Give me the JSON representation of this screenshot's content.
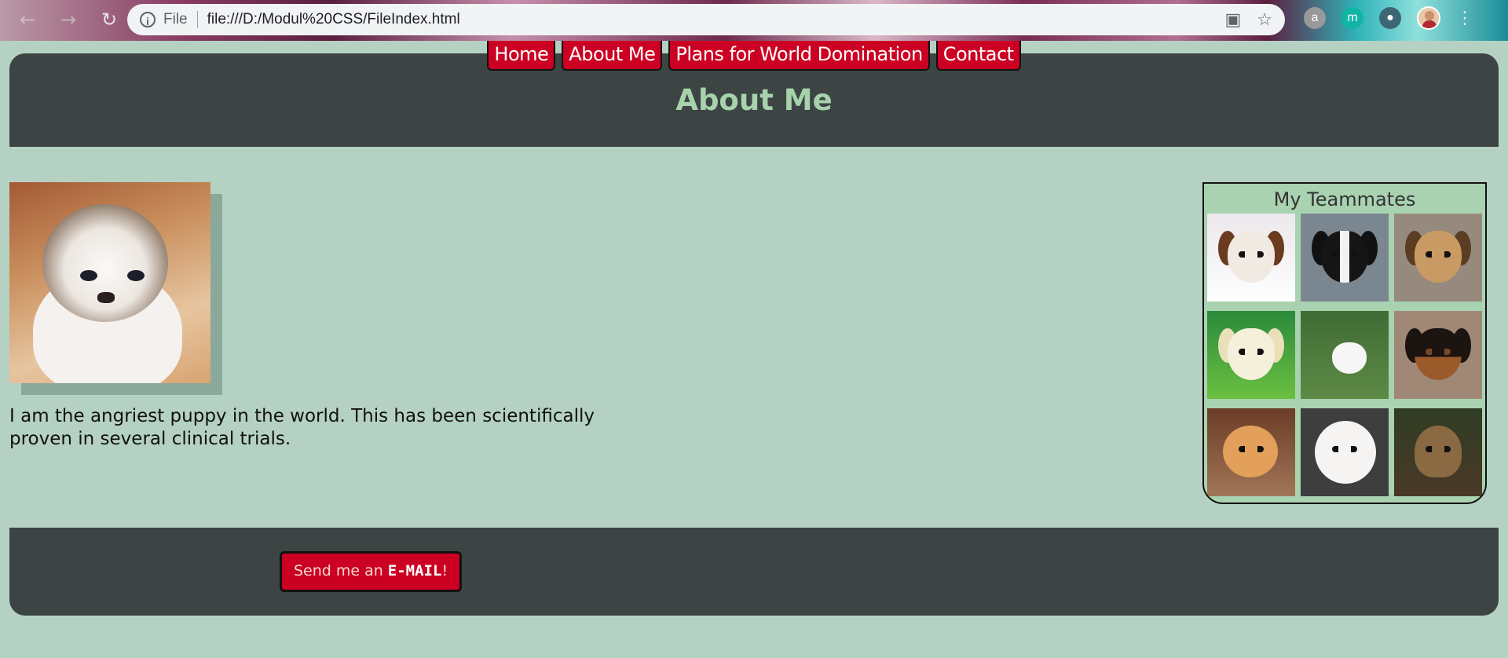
{
  "browser": {
    "scheme_label": "File",
    "url": "file:///D:/Modul%20CSS/FileIndex.html"
  },
  "nav": {
    "items": [
      "Home",
      "About Me",
      "Plans for World Domination",
      "Contact"
    ]
  },
  "header": {
    "title": "About Me"
  },
  "profile": {
    "text": "I am the angriest puppy in the world. This has been scientifically proven in several clinical trials."
  },
  "teammates": {
    "title": "My Teammates",
    "count": 9
  },
  "footer": {
    "mail_prefix": "Send me an ",
    "mail_strong": "E-MAIL",
    "mail_suffix": "!"
  },
  "colors": {
    "page_bg": "#b5d1c3",
    "panel_bg": "#3c4544",
    "accent_red": "#cc0022",
    "title_green": "#a8d2ac"
  }
}
